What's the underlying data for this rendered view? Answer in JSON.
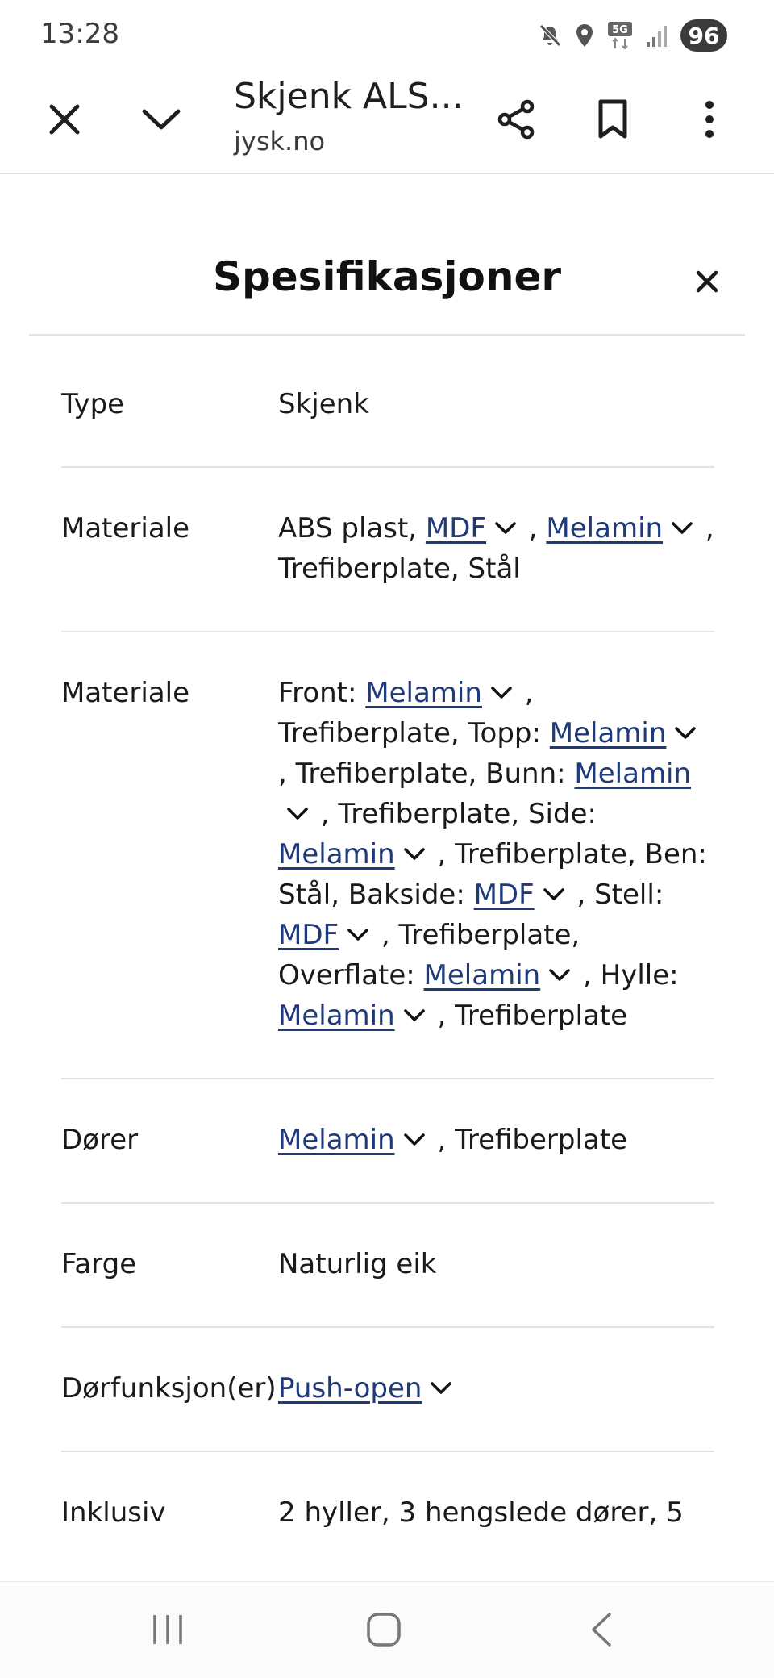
{
  "status": {
    "time": "13:28",
    "battery": "96",
    "network": "5G"
  },
  "toolbar": {
    "title": "Skjenk ALS...",
    "url": "jysk.no"
  },
  "panel": {
    "title": "Spesifikasjoner"
  },
  "specs": {
    "type": {
      "label": "Type",
      "value": "Skjenk"
    },
    "materiale1": {
      "label": "Materiale",
      "t1": "ABS plast, ",
      "l1": "MDF",
      "t2": " , ",
      "l2": "Melamin",
      "t3": " , Trefiberplate, Stål"
    },
    "materiale2": {
      "label": "Materiale",
      "t1": "Front: ",
      "l1": "Melamin",
      "t2": " , Trefiberplate, Topp: ",
      "l2": "Melamin",
      "t3": " , Trefiberplate, Bunn: ",
      "l3": "Melamin",
      "t4": " , Trefiberplate, Side: ",
      "l4": "Melamin",
      "t5": " , Trefiberplate, Ben: Stål, Bakside: ",
      "l5": "MDF",
      "t6": " , Stell: ",
      "l6": "MDF",
      "t7": " , Trefiberplate, Overflate: ",
      "l7": "Melamin",
      "t8": " , Hylle: ",
      "l8": "Melamin",
      "t9": " , Trefiberplate"
    },
    "dorer": {
      "label": "Dører",
      "l1": "Melamin",
      "t1": " , Trefiberplate"
    },
    "farge": {
      "label": "Farge",
      "value": "Naturlig eik"
    },
    "dorfunksjon": {
      "label": "Dørfunksjon(er)",
      "l1": "Push-open"
    },
    "inklusiv": {
      "label": "Inklusiv",
      "value": "2 hyller, 3 hengslede dører, 5"
    }
  },
  "colors": {
    "link": "#1e3a7b",
    "divider": "#e2e2e2",
    "text": "#1a1a1a"
  }
}
